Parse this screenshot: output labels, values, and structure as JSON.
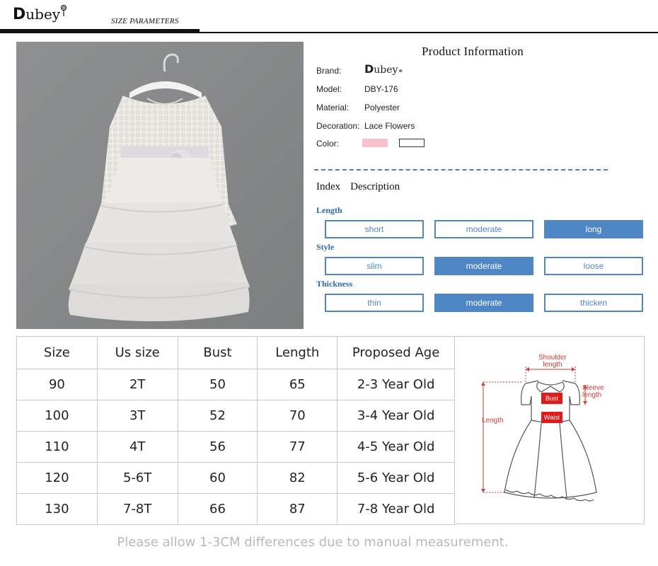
{
  "header": {
    "logo_initial": "D",
    "logo_rest": "ubey",
    "section_title": "SIZE PARAMETERS"
  },
  "product_info": {
    "title": "Product Information",
    "brand": {
      "label": "Brand:",
      "initial": "D",
      "rest": "ubey"
    },
    "model": {
      "label": "Model:",
      "value": "DBY-176"
    },
    "material": {
      "label": "Material:",
      "value": "Polyester"
    },
    "decoration": {
      "label": "Decoration:",
      "value": "Lace Flowers"
    },
    "color": {
      "label": "Color:",
      "swatches": [
        "#f6c0cc",
        "#ffffff"
      ]
    }
  },
  "index": {
    "index_label": "Index",
    "description_label": "Description",
    "length": {
      "label": "Length",
      "options": [
        "short",
        "moderate",
        "long"
      ],
      "selected": "long"
    },
    "style": {
      "label": "Style",
      "options": [
        "slim",
        "moderate",
        "loose"
      ],
      "selected": "moderate"
    },
    "thickness": {
      "label": "Thickness",
      "options": [
        "thin",
        "moderate",
        "thicken"
      ],
      "selected": "moderate"
    }
  },
  "size_table": {
    "headers": [
      "Size",
      "Us size",
      "Bust",
      "Length",
      "Proposed Age"
    ],
    "rows": [
      [
        "90",
        "2T",
        "50",
        "65",
        "2-3 Year Old"
      ],
      [
        "100",
        "3T",
        "52",
        "70",
        "3-4 Year Old"
      ],
      [
        "110",
        "4T",
        "56",
        "77",
        "4-5 Year Old"
      ],
      [
        "120",
        "5-6T",
        "60",
        "82",
        "5-6 Year Old"
      ],
      [
        "130",
        "7-8T",
        "66",
        "87",
        "7-8 Year Old"
      ]
    ]
  },
  "diagram": {
    "shoulder_line1": "Shoulder",
    "shoulder_line2": "length",
    "sleeve_line1": "Sleeve",
    "sleeve_line2": "length",
    "length": "Length",
    "bust": "Bust",
    "waist": "Waist"
  },
  "note": "Please allow 1-3CM differences due to manual measurement."
}
